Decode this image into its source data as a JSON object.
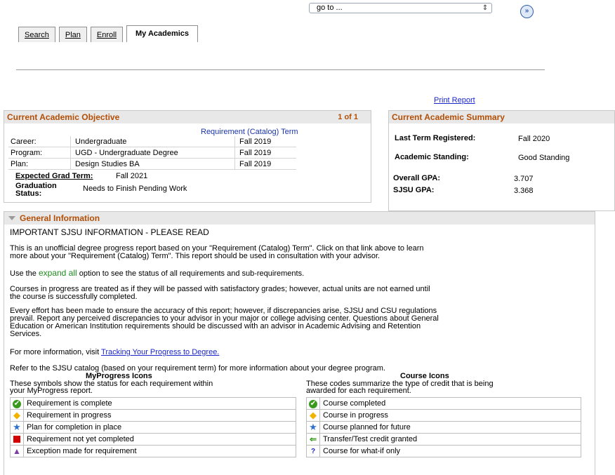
{
  "goto": {
    "value": "go to ...",
    "button": "»"
  },
  "tabs": [
    {
      "label": "Search"
    },
    {
      "label": "Plan"
    },
    {
      "label": "Enroll"
    },
    {
      "label": "My Academics"
    }
  ],
  "print_report": "Print Report",
  "objective": {
    "title": "Current Academic Objective",
    "count": "1 of 1",
    "req_term_link": "Requirement (Catalog) Term",
    "rows": [
      {
        "label": "Career:",
        "value": "Undergraduate",
        "term": "Fall 2019"
      },
      {
        "label": "Program:",
        "value": "UGD - Undergraduate Degree",
        "term": "Fall 2019"
      },
      {
        "label": "Plan:",
        "value": "Design Studies BA",
        "term": "Fall 2019"
      }
    ],
    "expected_grad_label": "Expected Grad Term:",
    "expected_grad_value": "Fall 2021",
    "grad_status_label1": "Graduation",
    "grad_status_label2": "Status:",
    "grad_status_value": "Needs to Finish Pending Work"
  },
  "summary": {
    "title": "Current Academic Summary",
    "last_term_label": "Last Term Registered:",
    "last_term_value": "Fall 2020",
    "standing_label": "Academic Standing:",
    "standing_value": "Good Standing",
    "overall_gpa_label": "Overall GPA:",
    "overall_gpa_value": "3.707",
    "sjsu_gpa_label": "SJSU GPA:",
    "sjsu_gpa_value": "3.368"
  },
  "general": {
    "title": "General Information",
    "heading": "IMPORTANT SJSU INFORMATION - PLEASE READ",
    "p1a": "This is an unofficial degree progress report based on your \"Requirement (Catalog) Term\". Click on that link above to learn",
    "p1b": "more about your \"Requirement (Catalog) Term\". This report should be used in consultation with your advisor.",
    "p2_pre": "Use the ",
    "p2_link": "expand all",
    "p2_post": " option to see the status of all requirements and sub-requirements.",
    "p3a": "Courses in progress are treated as if they will be passed with satisfactory grades; however, actual units are not earned until",
    "p3b": "the course is successfully completed.",
    "p4a": "Every effort has been made to ensure the accuracy of this report; however, if discrepancies arise, SJSU and CSU regulations",
    "p4b": "prevail. Report any perceived discrepancies to your advisor in your major or college advising center. Questions about General",
    "p4c": "Education or American Institution requirements should be discussed with an advisor in Academic Advising and Retention",
    "p4d": "Services.",
    "p5_pre": "For more information, visit ",
    "p5_link": "Tracking Your Progress to Degree.",
    "p6": "Refer to the SJSU catalog (based on your requirement term) for more information about your degree program.",
    "myprogress_title": "MyProgress Icons",
    "myprogress_desc1": "These symbols show the status for each requirement within",
    "myprogress_desc2": "your MyProgress report.",
    "myprogress_items": [
      {
        "icon": "check-icon",
        "label": "Requirement is complete",
        "color": "#3a9a1e"
      },
      {
        "icon": "diamond-icon",
        "label": "Requirement in progress",
        "color": "#f2b200"
      },
      {
        "icon": "star-icon",
        "label": "Plan for completion in place",
        "color": "#2f6fd0"
      },
      {
        "icon": "square-icon",
        "label": "Requirement not yet completed",
        "color": "#d40000"
      },
      {
        "icon": "triangle-icon",
        "label": "Exception made for requirement",
        "color": "#7b3fa0"
      }
    ],
    "course_title": "Course Icons",
    "course_desc1": "These codes summarize the type of credit that is being",
    "course_desc2": "awarded for each requirement.",
    "course_items": [
      {
        "icon": "check-icon",
        "label": "Course completed",
        "color": "#3a9a1e"
      },
      {
        "icon": "diamond-icon",
        "label": "Course in progress",
        "color": "#f2b200"
      },
      {
        "icon": "star-icon",
        "label": "Course planned for future",
        "color": "#2f6fd0"
      },
      {
        "icon": "transfer-arrow-icon",
        "label": "Transfer/Test credit granted",
        "color": "#3a9a1e"
      },
      {
        "icon": "question-icon",
        "label": "Course for what-if only",
        "color": "#1a25c9"
      }
    ]
  }
}
